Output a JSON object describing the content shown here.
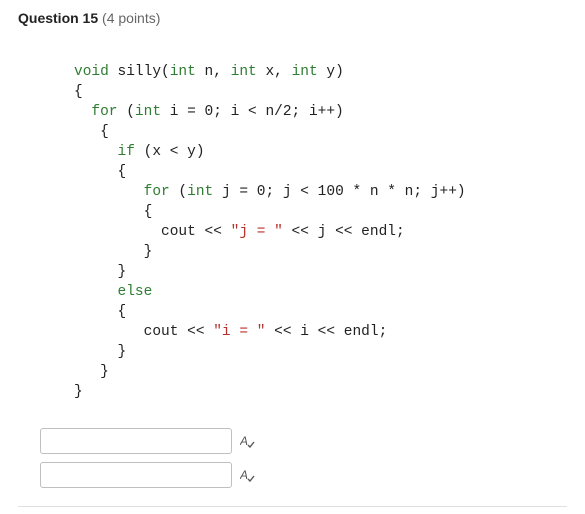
{
  "header": {
    "question_label": "Question 15",
    "points_label": "(4 points)"
  },
  "code": {
    "l1a": "void",
    "l1b": " silly(",
    "l1c": "int",
    "l1d": " n, ",
    "l1e": "int",
    "l1f": " x, ",
    "l1g": "int",
    "l1h": " y)",
    "l2": "{",
    "l3a": "  ",
    "l3b": "for",
    "l3c": " (",
    "l3d": "int",
    "l3e": " i = 0; i < n/2; i++)",
    "l4": "   {",
    "l5a": "     ",
    "l5b": "if",
    "l5c": " (x < y)",
    "l6": "     {",
    "l7a": "        ",
    "l7b": "for",
    "l7c": " (",
    "l7d": "int",
    "l7e": " j = 0; j < 100 * n * n; j++)",
    "l8": "        {",
    "l9a": "          cout << ",
    "l9b": "\"j = \"",
    "l9c": " << j << endl;",
    "l10": "        }",
    "l11": "     }",
    "l12a": "     ",
    "l12b": "else",
    "l13": "     {",
    "l14a": "        cout << ",
    "l14b": "\"i = \"",
    "l14c": " << i << endl;",
    "l15": "     }",
    "l16": "   }",
    "l17": "}"
  },
  "answers": {
    "field1": "",
    "field2": ""
  },
  "icons": {
    "spellcheck": "spellcheck-icon"
  }
}
